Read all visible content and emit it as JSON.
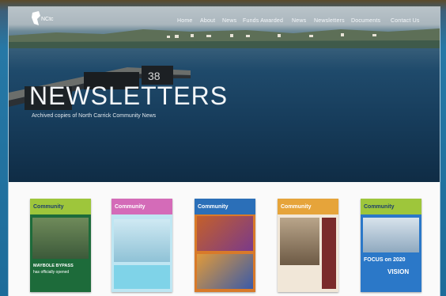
{
  "nav": {
    "logo_text": "NCtc",
    "items": [
      {
        "label": "Home"
      },
      {
        "label": "About"
      },
      {
        "label": "News"
      },
      {
        "label": "Funds Awarded"
      },
      {
        "label": "News"
      },
      {
        "label": "Newsletters"
      },
      {
        "label": "Documents"
      },
      {
        "label": "Contact Us"
      }
    ]
  },
  "hero": {
    "title": "NEWSLETTERS",
    "subtitle": "Archived copies of North Carrick Community News"
  },
  "covers": [
    {
      "masthead": "Community",
      "caption": "MAYBOLE BYPASS",
      "caption2": "has officially opened",
      "mast_color": "#9ec63b",
      "body_color": "#1d6b3a"
    },
    {
      "masthead": "Community",
      "caption": "",
      "caption2": "",
      "mast_color": "#d46bb8",
      "body_color": "#7fd3e8"
    },
    {
      "masthead": "Community",
      "caption": "",
      "caption2": "",
      "mast_color": "#2b6fb8",
      "body_color": "#d87a2a"
    },
    {
      "masthead": "Community",
      "caption": "",
      "caption2": "",
      "mast_color": "#e6a43a",
      "body_color": "#7a2b2b"
    },
    {
      "masthead": "Community",
      "caption": "FOCUS on 2020",
      "caption2": "VISION",
      "mast_color": "#9ec63b",
      "body_color": "#2b78c8"
    }
  ]
}
